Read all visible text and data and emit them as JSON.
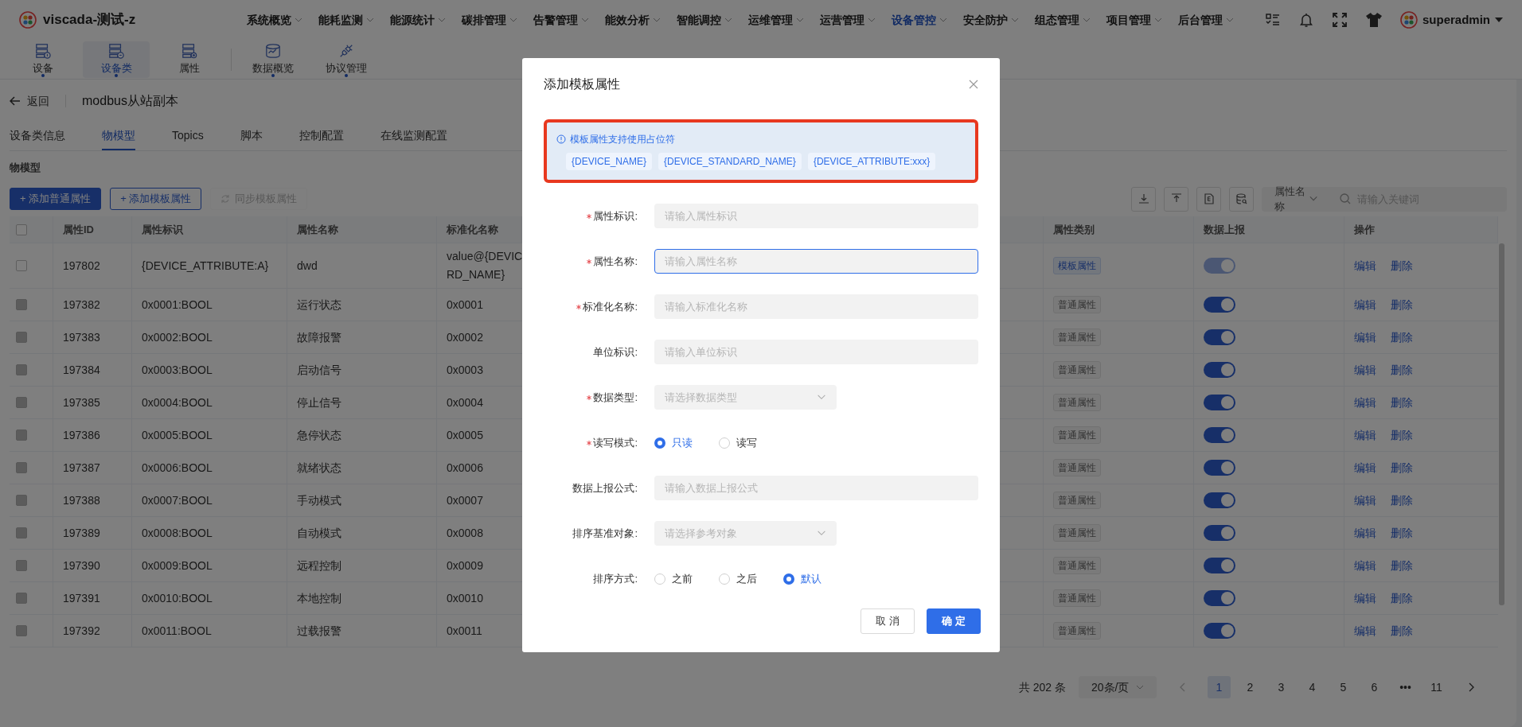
{
  "header": {
    "app_name": "viscada-测试-z",
    "user": "superadmin",
    "menu": [
      {
        "label": "系统概览",
        "selected": false
      },
      {
        "label": "能耗监测",
        "selected": false
      },
      {
        "label": "能源统计",
        "selected": false
      },
      {
        "label": "碳排管理",
        "selected": false
      },
      {
        "label": "告警管理",
        "selected": false
      },
      {
        "label": "能效分析",
        "selected": false
      },
      {
        "label": "智能调控",
        "selected": false
      },
      {
        "label": "运维管理",
        "selected": false
      },
      {
        "label": "运营管理",
        "selected": false
      },
      {
        "label": "设备管控",
        "selected": true
      },
      {
        "label": "安全防护",
        "selected": false
      },
      {
        "label": "组态管理",
        "selected": false
      },
      {
        "label": "项目管理",
        "selected": false
      },
      {
        "label": "后台管理",
        "selected": false
      }
    ]
  },
  "subnav": [
    {
      "label": "设备",
      "kind": "device",
      "selected": false,
      "dot": true
    },
    {
      "label": "设备类",
      "kind": "device_class",
      "selected": true,
      "dot": true
    },
    {
      "label": "属性",
      "kind": "attribute",
      "selected": false,
      "dot": false
    },
    {
      "label": "数据概览",
      "kind": "data",
      "selected": false,
      "dot": true
    },
    {
      "label": "协议管理",
      "kind": "protocol",
      "selected": false,
      "dot": true
    }
  ],
  "back": "返回",
  "page_title": "modbus从站副本",
  "tabs": [
    {
      "label": "设备类信息",
      "selected": false
    },
    {
      "label": "物模型",
      "selected": true
    },
    {
      "label": "Topics",
      "selected": false
    },
    {
      "label": "脚本",
      "selected": false
    },
    {
      "label": "控制配置",
      "selected": false
    },
    {
      "label": "在线监测配置",
      "selected": false
    }
  ],
  "section_title": "物模型",
  "actions": [
    {
      "label": "+ 添加普通属性",
      "kind": "primary",
      "disabled": false
    },
    {
      "label": "+ 添加模板属性",
      "kind": "outline",
      "disabled": false
    },
    {
      "label": "同步模板属性",
      "kind": "sync",
      "disabled": true
    }
  ],
  "tools": [
    {
      "kind": "download"
    },
    {
      "kind": "upload"
    },
    {
      "kind": "file"
    },
    {
      "kind": "db-search"
    }
  ],
  "filter": {
    "field": "属性名称",
    "placeholder": "请输入关键词"
  },
  "table": {
    "select_all_checked": false,
    "columns": [
      "属性ID",
      "属性标识",
      "属性名称",
      "标准化名称",
      "属性类别",
      "数据上报",
      "操作"
    ],
    "rows": [
      {
        "checkbox_disabled": false,
        "id": "197802",
        "identifier": "{DEVICE_ATTRIBUTE:A}",
        "name": "dwd",
        "standard_name": [
          "value@{DEVIC",
          "RD_NAME}"
        ],
        "category": {
          "label": "模板属性",
          "kind": "template"
        },
        "report": {
          "on": true,
          "disabled": true
        },
        "ops": [
          "编辑",
          "删除"
        ]
      },
      {
        "checkbox_disabled": true,
        "id": "197382",
        "identifier": "0x0001:BOOL",
        "name": "运行状态",
        "standard_name": [
          "0x0001"
        ],
        "category": {
          "label": "普通属性",
          "kind": "normal"
        },
        "report": {
          "on": true,
          "disabled": false
        },
        "ops": [
          "编辑",
          "删除"
        ]
      },
      {
        "checkbox_disabled": true,
        "id": "197383",
        "identifier": "0x0002:BOOL",
        "name": "故障报警",
        "standard_name": [
          "0x0002"
        ],
        "category": {
          "label": "普通属性",
          "kind": "normal"
        },
        "report": {
          "on": true,
          "disabled": false
        },
        "ops": [
          "编辑",
          "删除"
        ]
      },
      {
        "checkbox_disabled": true,
        "id": "197384",
        "identifier": "0x0003:BOOL",
        "name": "启动信号",
        "standard_name": [
          "0x0003"
        ],
        "category": {
          "label": "普通属性",
          "kind": "normal"
        },
        "report": {
          "on": true,
          "disabled": false
        },
        "ops": [
          "编辑",
          "删除"
        ]
      },
      {
        "checkbox_disabled": true,
        "id": "197385",
        "identifier": "0x0004:BOOL",
        "name": "停止信号",
        "standard_name": [
          "0x0004"
        ],
        "category": {
          "label": "普通属性",
          "kind": "normal"
        },
        "report": {
          "on": true,
          "disabled": false
        },
        "ops": [
          "编辑",
          "删除"
        ]
      },
      {
        "checkbox_disabled": true,
        "id": "197386",
        "identifier": "0x0005:BOOL",
        "name": "急停状态",
        "standard_name": [
          "0x0005"
        ],
        "category": {
          "label": "普通属性",
          "kind": "normal"
        },
        "report": {
          "on": true,
          "disabled": false
        },
        "ops": [
          "编辑",
          "删除"
        ]
      },
      {
        "checkbox_disabled": true,
        "id": "197387",
        "identifier": "0x0006:BOOL",
        "name": "就绪状态",
        "standard_name": [
          "0x0006"
        ],
        "category": {
          "label": "普通属性",
          "kind": "normal"
        },
        "report": {
          "on": true,
          "disabled": false
        },
        "ops": [
          "编辑",
          "删除"
        ]
      },
      {
        "checkbox_disabled": true,
        "id": "197388",
        "identifier": "0x0007:BOOL",
        "name": "手动模式",
        "standard_name": [
          "0x0007"
        ],
        "category": {
          "label": "普通属性",
          "kind": "normal"
        },
        "report": {
          "on": true,
          "disabled": false
        },
        "ops": [
          "编辑",
          "删除"
        ]
      },
      {
        "checkbox_disabled": true,
        "id": "197389",
        "identifier": "0x0008:BOOL",
        "name": "自动模式",
        "standard_name": [
          "0x0008"
        ],
        "category": {
          "label": "普通属性",
          "kind": "normal"
        },
        "report": {
          "on": true,
          "disabled": false
        },
        "ops": [
          "编辑",
          "删除"
        ]
      },
      {
        "checkbox_disabled": true,
        "id": "197390",
        "identifier": "0x0009:BOOL",
        "name": "远程控制",
        "standard_name": [
          "0x0009"
        ],
        "category": {
          "label": "普通属性",
          "kind": "normal"
        },
        "report": {
          "on": true,
          "disabled": false
        },
        "ops": [
          "编辑",
          "删除"
        ]
      },
      {
        "checkbox_disabled": true,
        "id": "197391",
        "identifier": "0x0010:BOOL",
        "name": "本地控制",
        "standard_name": [
          "0x0010"
        ],
        "category": {
          "label": "普通属性",
          "kind": "normal"
        },
        "report": {
          "on": true,
          "disabled": false
        },
        "ops": [
          "编辑",
          "删除"
        ]
      },
      {
        "checkbox_disabled": true,
        "id": "197392",
        "identifier": "0x0011:BOOL",
        "name": "过载报警",
        "standard_name": [
          "0x0011"
        ],
        "category": {
          "label": "普通属性",
          "kind": "normal"
        },
        "report": {
          "on": true,
          "disabled": false
        },
        "ops": [
          "编辑",
          "删除"
        ]
      }
    ]
  },
  "pagination": {
    "total": "共 202 条",
    "page_size": "20条/页",
    "prev_disabled": true,
    "pages": [
      {
        "label": "1",
        "selected": true
      },
      {
        "label": "2",
        "selected": false
      },
      {
        "label": "3",
        "selected": false
      },
      {
        "label": "4",
        "selected": false
      },
      {
        "label": "5",
        "selected": false
      },
      {
        "label": "6",
        "selected": false
      },
      {
        "label": "•••",
        "selected": false
      },
      {
        "label": "11",
        "selected": false
      }
    ]
  },
  "dialog": {
    "title": "添加模板属性",
    "info": {
      "text": "模板属性支持使用占位符",
      "highlighted": true,
      "placeholders": [
        "{DEVICE_NAME}",
        "{DEVICE_STANDARD_NAME}",
        "{DEVICE_ATTRIBUTE:xxx}"
      ]
    },
    "fields": [
      {
        "kind": "input",
        "label": "属性标识:",
        "required": true,
        "placeholder": "请输入属性标识",
        "focused": false
      },
      {
        "kind": "input",
        "label": "属性名称:",
        "required": true,
        "placeholder": "请输入属性名称",
        "focused": true
      },
      {
        "kind": "input",
        "label": "标准化名称:",
        "required": true,
        "placeholder": "请输入标准化名称",
        "focused": false
      },
      {
        "kind": "input",
        "label": "单位标识:",
        "required": false,
        "placeholder": "请输入单位标识",
        "focused": false
      },
      {
        "kind": "select",
        "label": "数据类型:",
        "required": true,
        "placeholder": "请选择数据类型",
        "focused": false
      },
      {
        "kind": "radio",
        "label": "读写模式:",
        "required": true,
        "options": [
          {
            "label": "只读",
            "selected": true
          },
          {
            "label": "读写",
            "selected": false
          }
        ]
      },
      {
        "kind": "input",
        "label": "数据上报公式:",
        "required": false,
        "placeholder": "请输入数据上报公式",
        "focused": false
      },
      {
        "kind": "select",
        "label": "排序基准对象:",
        "required": false,
        "placeholder": "请选择参考对象",
        "focused": false
      },
      {
        "kind": "radio",
        "label": "排序方式:",
        "required": false,
        "options": [
          {
            "label": "之前",
            "selected": false
          },
          {
            "label": "之后",
            "selected": false
          },
          {
            "label": "默认",
            "selected": true
          }
        ]
      }
    ],
    "buttons": [
      {
        "label": "取 消",
        "kind": "default"
      },
      {
        "label": "确 定",
        "kind": "primary"
      }
    ]
  }
}
